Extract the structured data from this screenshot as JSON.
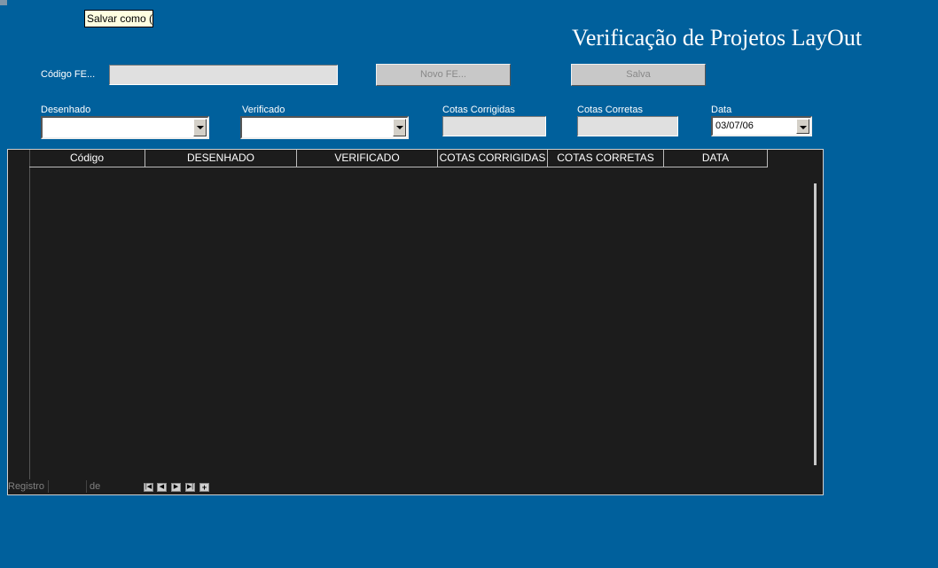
{
  "tooltip": "Salvar como (C",
  "title": "Verificação de Projetos LayOut",
  "form": {
    "codigo_label": "Código FE...",
    "codigo_value": "",
    "novo_button": "Novo FE...",
    "salva_button": "Salva",
    "desenhado_label": "Desenhado",
    "verificado_label": "Verificado",
    "cotas_corrigidas_label": "Cotas Corrigidas",
    "cotas_corretas_label": "Cotas Corretas",
    "data_label": "Data",
    "data_value": "03/07/06"
  },
  "grid": {
    "columns": [
      "Código",
      "DESENHADO",
      "VERIFICADO",
      "COTAS CORRIGIDAS",
      "COTAS CORRETAS",
      "DATA"
    ],
    "rows": []
  },
  "footer": {
    "registro_label": "Registro",
    "de_label": "de"
  },
  "colors": {
    "background": "#00609c",
    "grid_background": "#1c1c1c"
  }
}
